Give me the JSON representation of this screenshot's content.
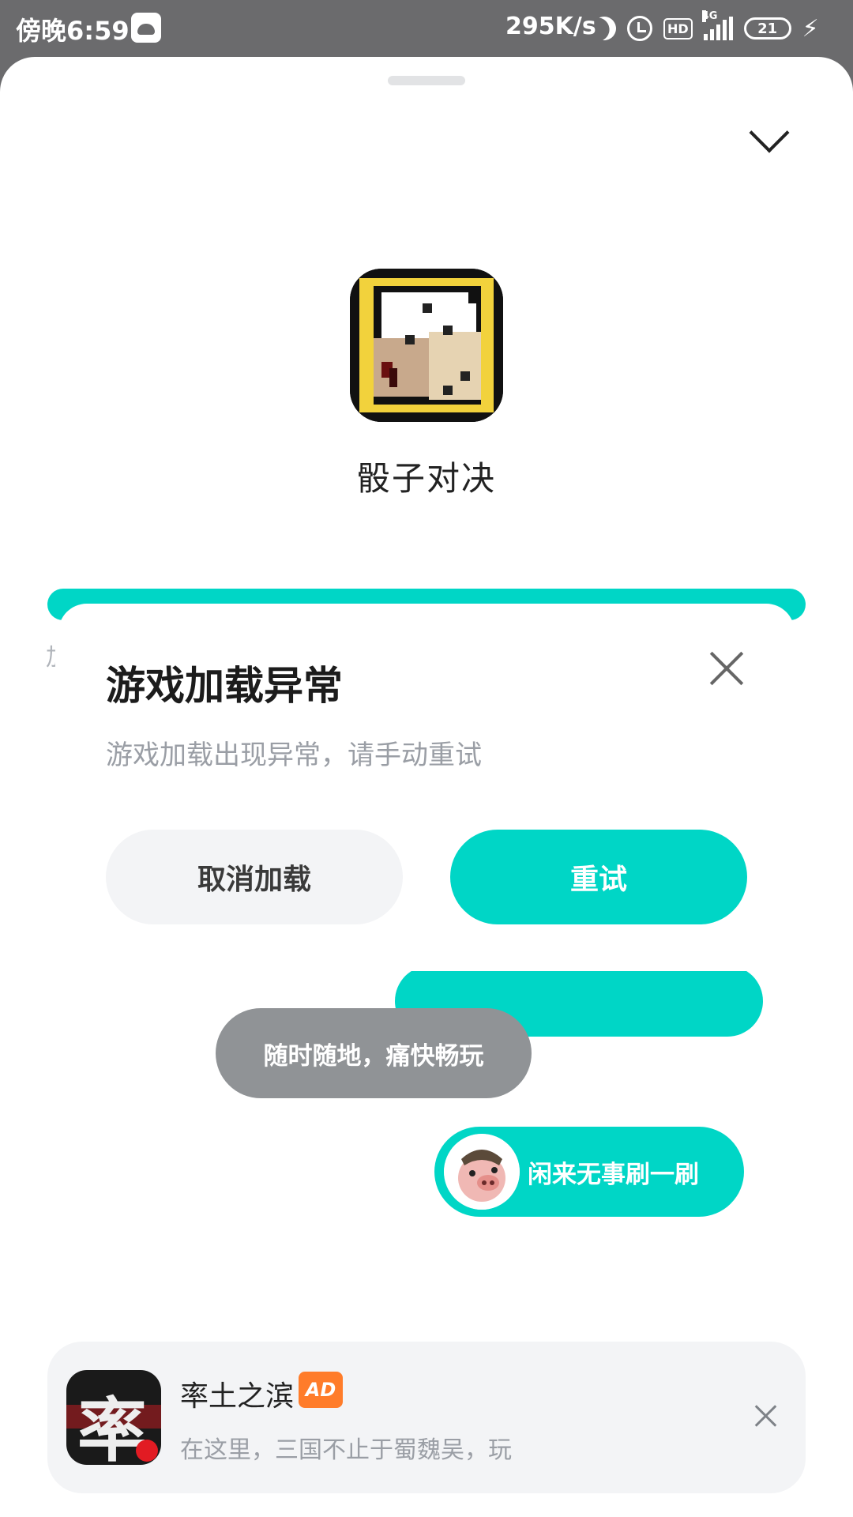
{
  "status_bar": {
    "time": "傍晚6:59",
    "net_speed": "295K/s",
    "network": "4G",
    "hd": "HD",
    "battery": "21"
  },
  "game": {
    "name": "骰子对决"
  },
  "chat": {
    "bubble_1": "随时随地，痛快畅玩",
    "bubble_2": "闲来无事刷一刷"
  },
  "dialog": {
    "title": "游戏加载异常",
    "message": "游戏加载出现异常，请手动重试",
    "cancel_label": "取消加载",
    "retry_label": "重试"
  },
  "ad": {
    "title": "率土之滨",
    "tag": "AD",
    "description": "在这里，三国不止于蜀魏吴，玩",
    "icon_glyph": "率"
  },
  "colors": {
    "accent": "#00d6c6",
    "status_bar": "#6b6b6d",
    "ad_tag": "#ff7c2a"
  }
}
